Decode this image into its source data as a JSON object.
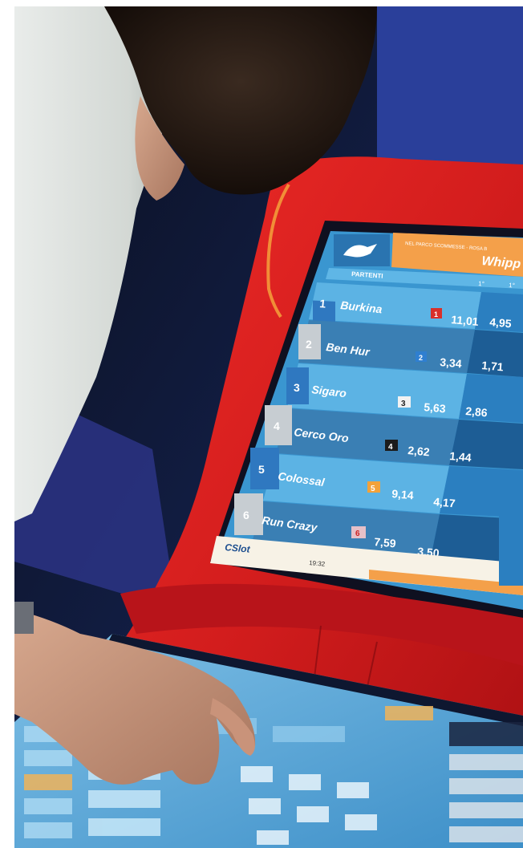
{
  "screen": {
    "header_title": "PARTENTI",
    "banner_text": "Whipp",
    "banner_small": "NEL PARCO SCOMMESSE - ROSA B",
    "col_labels": [
      "1°",
      "1°"
    ],
    "footer_brand": "CSlot",
    "footer_time": "19:32"
  },
  "runners": [
    {
      "num": "1",
      "name": "Burkina",
      "badge": "1",
      "odds_win": "11,01",
      "odds_place": "4,95",
      "badge_color": "#d8302a"
    },
    {
      "num": "2",
      "name": "Ben Hur",
      "badge": "2",
      "odds_win": "3,34",
      "odds_place": "1,71",
      "badge_color": "#2f7fd0"
    },
    {
      "num": "3",
      "name": "Sigaro",
      "badge": "3",
      "odds_win": "5,63",
      "odds_place": "2,86",
      "badge_color": "#f2f2f2"
    },
    {
      "num": "4",
      "name": "Cerco Oro",
      "badge": "4",
      "odds_win": "2,62",
      "odds_place": "1,44",
      "badge_color": "#1b1b1b"
    },
    {
      "num": "5",
      "name": "Colossal",
      "badge": "5",
      "odds_win": "9,14",
      "odds_place": "4,17",
      "badge_color": "#f2a23a"
    },
    {
      "num": "6",
      "name": "Run Crazy",
      "badge": "6",
      "odds_win": "7,59",
      "odds_place": "3,50",
      "badge_color": "#e6c0c8"
    }
  ],
  "colors": {
    "cabinet_red": "#d61f1f",
    "screen_blue": "#4aa6d9",
    "banner_orange": "#f4a04a",
    "background_navy": "#1c2a4d"
  }
}
